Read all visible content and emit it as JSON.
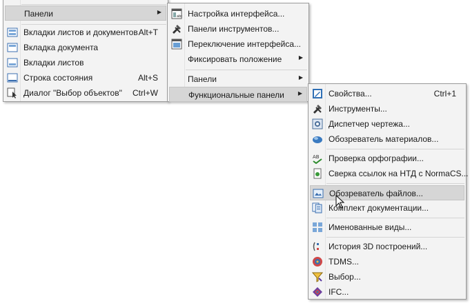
{
  "menu1": {
    "items": [
      {
        "label": "Панели",
        "shortcut": "",
        "icon": "blank"
      },
      {
        "label": "Вкладки листов и документов",
        "shortcut": "Alt+T",
        "icon": "tabs-icon"
      },
      {
        "label": "Вкладка документа",
        "shortcut": "",
        "icon": "doc-tab-icon"
      },
      {
        "label": "Вкладки листов",
        "shortcut": "",
        "icon": "sheet-tabs-icon"
      },
      {
        "label": "Строка состояния",
        "shortcut": "Alt+S",
        "icon": "status-bar-icon"
      },
      {
        "label": "Диалог \"Выбор объектов\"",
        "shortcut": "Ctrl+W",
        "icon": "select-dialog-icon"
      }
    ]
  },
  "menu2": {
    "items": [
      {
        "label": "Настройка интерфейса...",
        "icon": "interface-settings-icon"
      },
      {
        "label": "Панели инструментов...",
        "icon": "tools-icon"
      },
      {
        "label": "Переключение интерфейса...",
        "icon": "switch-interface-icon"
      },
      {
        "label": "Фиксировать положение",
        "icon": "blank"
      },
      {
        "label": "Панели",
        "icon": "blank"
      },
      {
        "label": "Функциональные панели",
        "icon": "blank"
      }
    ]
  },
  "menu3": {
    "items": [
      {
        "label": "Свойства...",
        "shortcut": "Ctrl+1",
        "icon": "properties-icon"
      },
      {
        "label": "Инструменты...",
        "shortcut": "",
        "icon": "tools-icon"
      },
      {
        "label": "Диспетчер чертежа...",
        "shortcut": "",
        "icon": "drawing-manager-icon"
      },
      {
        "label": "Обозреватель материалов...",
        "shortcut": "",
        "icon": "materials-icon"
      },
      {
        "label": "Проверка орфографии...",
        "shortcut": "",
        "icon": "spellcheck-icon"
      },
      {
        "label": "Сверка ссылок на НТД с NormaCS...",
        "shortcut": "",
        "icon": "normacs-icon"
      },
      {
        "label": "Обозреватель файлов...",
        "shortcut": "",
        "icon": "file-browser-icon"
      },
      {
        "label": "Комплект документации...",
        "shortcut": "",
        "icon": "doc-set-icon"
      },
      {
        "label": "Именованные виды...",
        "shortcut": "",
        "icon": "named-views-icon"
      },
      {
        "label": "История 3D построений...",
        "shortcut": "",
        "icon": "history-3d-icon"
      },
      {
        "label": "TDMS...",
        "shortcut": "",
        "icon": "tdms-icon"
      },
      {
        "label": "Выбор...",
        "shortcut": "",
        "icon": "selection-icon"
      },
      {
        "label": "IFC...",
        "shortcut": "",
        "icon": "ifc-icon"
      }
    ]
  }
}
